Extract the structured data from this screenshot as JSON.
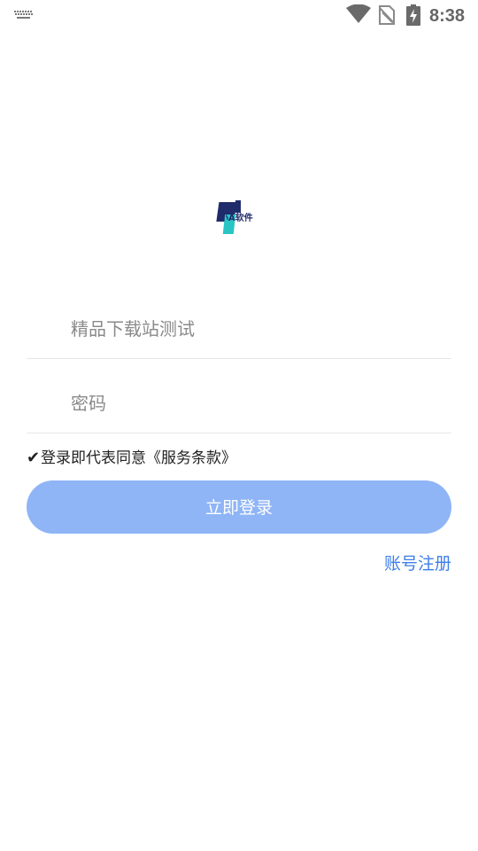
{
  "status_bar": {
    "time": "8:38",
    "icons": [
      "keyboard-icon",
      "wifi-icon",
      "no-sim-icon",
      "battery-charging-icon"
    ]
  },
  "logo": {
    "text": "小A软件",
    "colors": {
      "dark": "#1f2b6b",
      "teal": "#29c4c4"
    }
  },
  "form": {
    "account_placeholder": "精品下载站测试",
    "password_placeholder": "密码"
  },
  "agreement": {
    "check_mark": "✔",
    "text": "登录即代表同意《服务条款》"
  },
  "login_button": {
    "label": "立即登录",
    "color": "#8fb5f6"
  },
  "register_link": {
    "label": "账号注册",
    "color": "#3d7fe8"
  }
}
